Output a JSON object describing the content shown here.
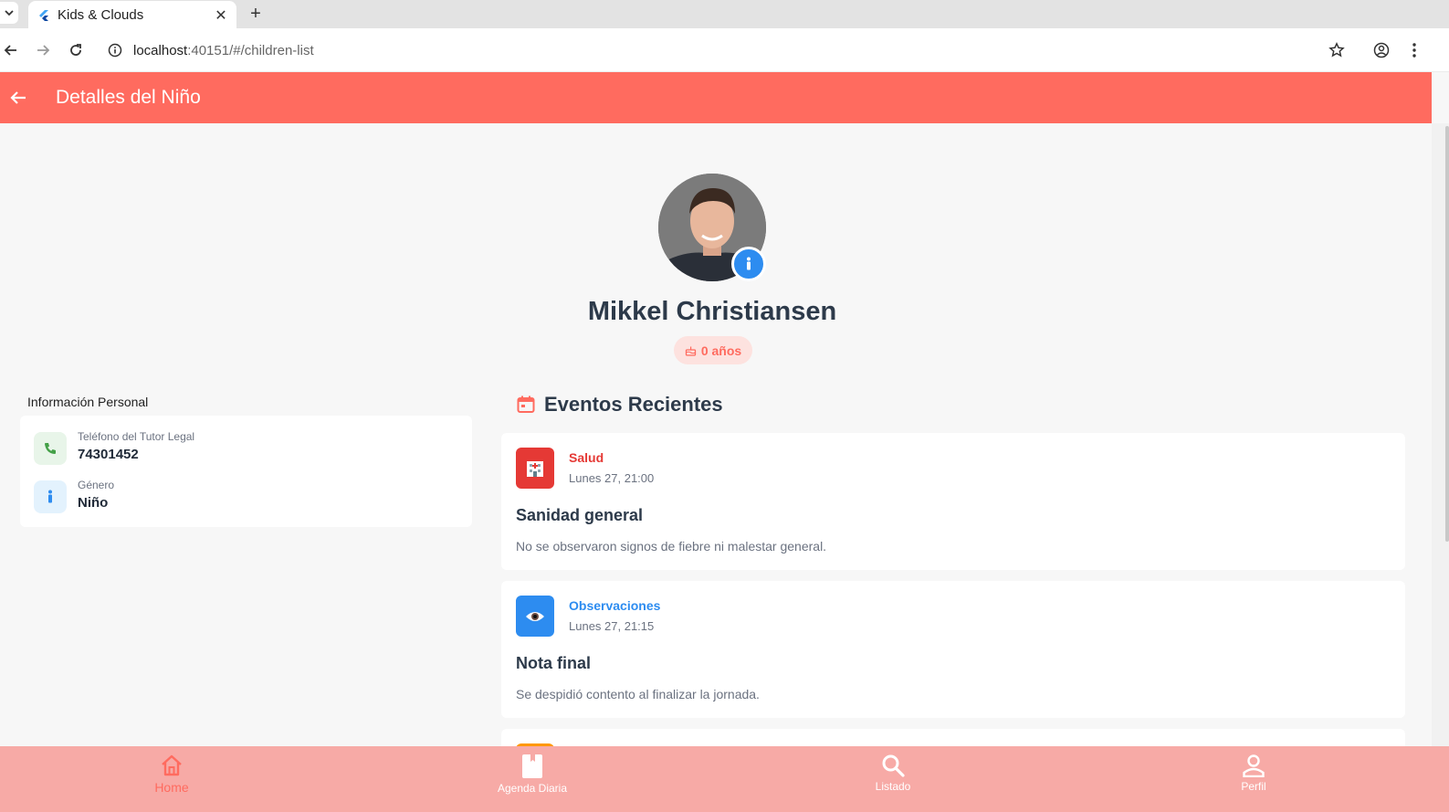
{
  "browser": {
    "tab_title": "Kids & Clouds",
    "url_host": "localhost",
    "url_rest": ":40151/#/children-list"
  },
  "appbar": {
    "title": "Detalles del Niño"
  },
  "profile": {
    "name": "Mikkel Christiansen",
    "age": "0 años"
  },
  "personal_info": {
    "heading": "Información Personal",
    "rows": [
      {
        "label": "Teléfono del Tutor Legal",
        "value": "74301452",
        "icon": "phone-icon",
        "color": "#e8f5e9"
      },
      {
        "label": "Género",
        "value": "Niño",
        "icon": "person-icon",
        "color": "#e3f2fd"
      }
    ]
  },
  "events": {
    "heading": "Eventos Recientes",
    "items": [
      {
        "category": "Salud",
        "category_color": "#e53935",
        "icon": "hospital-icon",
        "icon_bg": "#e53935",
        "time": "Lunes 27, 21:00",
        "title": "Sanidad general",
        "description": "No se observaron signos de fiebre ni malestar general."
      },
      {
        "category": "Observaciones",
        "category_color": "#2d8cf0",
        "icon": "eye-icon",
        "icon_bg": "#2d8cf0",
        "time": "Lunes 27, 21:15",
        "title": "Nota final",
        "description": "Se despidió contento al finalizar la jornada."
      }
    ]
  },
  "bottom_nav": {
    "items": [
      {
        "label": "Home",
        "icon": "home-icon",
        "active": true
      },
      {
        "label": "Agenda Diaria",
        "icon": "book-icon",
        "active": false
      },
      {
        "label": "Listado",
        "icon": "search-icon",
        "active": false
      },
      {
        "label": "Perfil",
        "icon": "profile-icon",
        "active": false
      }
    ]
  },
  "colors": {
    "primary": "#ff6b5f",
    "nav_bg": "#f7aaa6",
    "accent_blue": "#2d8cf0"
  }
}
